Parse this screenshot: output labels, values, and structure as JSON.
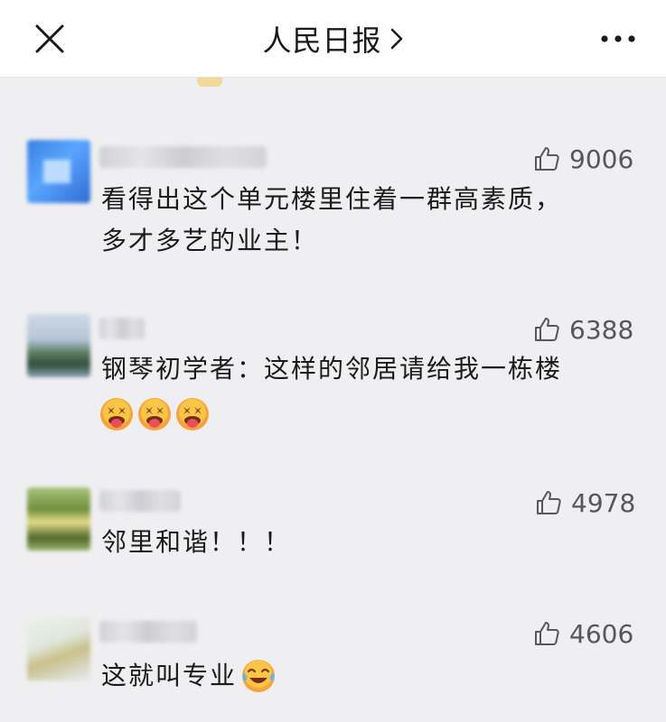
{
  "header": {
    "title": "人民日报",
    "close_icon": "close-icon",
    "chevron_icon": "chevron-right-icon",
    "more_icon": "more-dots-icon"
  },
  "comments": [
    {
      "likes": "9006",
      "lines": [
        "看得出这个单元楼里住着一群高素质，",
        "多才多艺的业主！"
      ]
    },
    {
      "likes": "6388",
      "lines": [
        "钢琴初学者：这样的邻居请给我一栋楼"
      ],
      "emoji_count": 3
    },
    {
      "likes": "4978",
      "lines": [
        "邻里和谐！！！"
      ]
    },
    {
      "likes": "4606",
      "lines": [
        "这就叫专业"
      ],
      "trailing_emoji": "crying-laughing"
    }
  ],
  "colors": {
    "background": "#efeff1",
    "like_text": "#55575f",
    "text": "#1b1b1b"
  }
}
